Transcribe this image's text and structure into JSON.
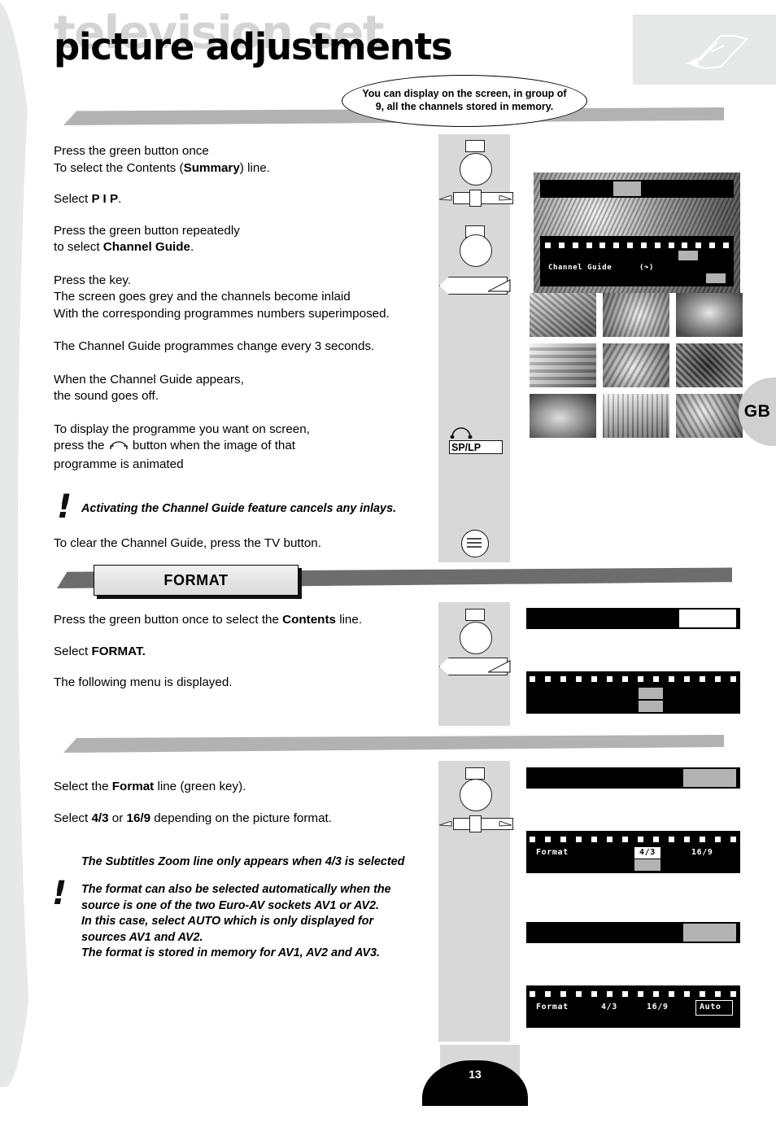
{
  "header": {
    "ghost_title": "television set",
    "title": "picture adjustments",
    "watermark_icon": "remote-control-icon"
  },
  "callout": {
    "line1": "You can display on the screen, in group of",
    "line2": "9, all the channels stored in memory."
  },
  "language_tab": {
    "label": "GB"
  },
  "page_number": "13",
  "section1": {
    "paragraphs": [
      {
        "id": "p1",
        "lines": [
          "Press the green button once",
          "To select the Contents (Summary) line."
        ],
        "bold": [
          "Summary"
        ]
      },
      {
        "id": "p2",
        "lines": [
          "Select P I P."
        ],
        "bold": [
          "P I P"
        ]
      },
      {
        "id": "p3",
        "lines": [
          "Press the green button repeatedly",
          "to select Channel Guide."
        ],
        "bold": [
          "Channel Guide"
        ]
      },
      {
        "id": "p4",
        "lines": [
          "Press the key.",
          "The screen goes grey and the channels become inlaid",
          "With the corresponding programmes numbers superimposed."
        ]
      },
      {
        "id": "p5",
        "lines": [
          "The Channel Guide programmes change every 3 seconds."
        ]
      },
      {
        "id": "p6",
        "lines": [
          "When the Channel Guide appears,",
          "the sound goes off."
        ]
      },
      {
        "id": "p7",
        "lines": [
          "To display the programme you want on screen,",
          "press the  button when the image of that",
          "programme is animated"
        ]
      }
    ],
    "p1_a": "Press the green button once",
    "p1_b_pre": "To select the Contents (",
    "p1_b_bold": "Summary",
    "p1_b_post": ") line.",
    "p2_pre": "Select ",
    "p2_bold": "P I P",
    "p2_post": ".",
    "p3_a": "Press the green button repeatedly",
    "p3_b_pre": "to select ",
    "p3_b_bold": "Channel Guide",
    "p3_b_post": ".",
    "p4_a": "Press the key.",
    "p4_b": "The screen goes grey and the channels become inlaid",
    "p4_c": "With the corresponding programmes numbers superimposed.",
    "p5": "The Channel Guide programmes change every 3 seconds.",
    "p6_a": "When the Channel Guide appears,",
    "p6_b": "the sound goes off.",
    "p7_a": "To display the programme you want on screen,",
    "p7_b_pre": "press the ",
    "p7_b_post": " button when the image of that",
    "p7_c": "programme is animated",
    "note": "Activating the Channel Guide feature cancels any inlays.",
    "closing": "To clear the Channel Guide, press the TV button.",
    "bang": "!"
  },
  "section2": {
    "banner": "FORMAT",
    "p1_pre": "Press the green button once to select the ",
    "p1_bold": "Contents",
    "p1_post": " line.",
    "p2_pre": "Select ",
    "p2_bold": "FORMAT.",
    "p3": "The following menu is displayed."
  },
  "section3": {
    "p1_pre": "Select the ",
    "p1_bold": "Format",
    "p1_post": " line (green key).",
    "p2_pre": "Select ",
    "p2_bold_a": "4/3",
    "p2_mid": " or ",
    "p2_bold_b": "16/9",
    "p2_post": " depending on the picture format.",
    "note1": "The Subtitles Zoom line only appears when 4/3 is selected",
    "note2_l1": "The format can also be selected automatically when the",
    "note2_l2": "source is one of the two Euro-AV sockets AV1 or AV2.",
    "note2_l3": "In this case, select AUTO which is only displayed for",
    "note2_l4": "sources AV1 and AV2.",
    "note2_l5": "The format is stored in memory for AV1, AV2 and AV3.",
    "bang": "!"
  },
  "remote_icons": {
    "green_button": "green-button-icon",
    "cursor_bar": "cursor-bar-icon",
    "arrow_key": "arrow-key-icon",
    "splp_label": "SP/LP",
    "headphone": "headphone-arc-icon",
    "tv_menu": "tv-menu-icon"
  },
  "osd_channel_guide": {
    "title_line": "",
    "menu_label": "Channel Guide",
    "menu_symbol": "(↷)"
  },
  "osd_format_empty": {
    "label": ""
  },
  "osd_format_2": {
    "label": "Format",
    "option_a": "4/3",
    "option_b": "16/9",
    "selected": "4/3"
  },
  "osd_format_3": {
    "label": "Format",
    "option_a": "4/3",
    "option_b": "16/9",
    "option_c": "Auto",
    "selected": "Auto"
  },
  "colors": {
    "accent_grey": "#d8d8d8",
    "band_grey": "#b2b2b2",
    "dark_wedge": "#6d6d6d",
    "osd_black": "#000000",
    "osd_highlight": "#b3b3b3"
  }
}
